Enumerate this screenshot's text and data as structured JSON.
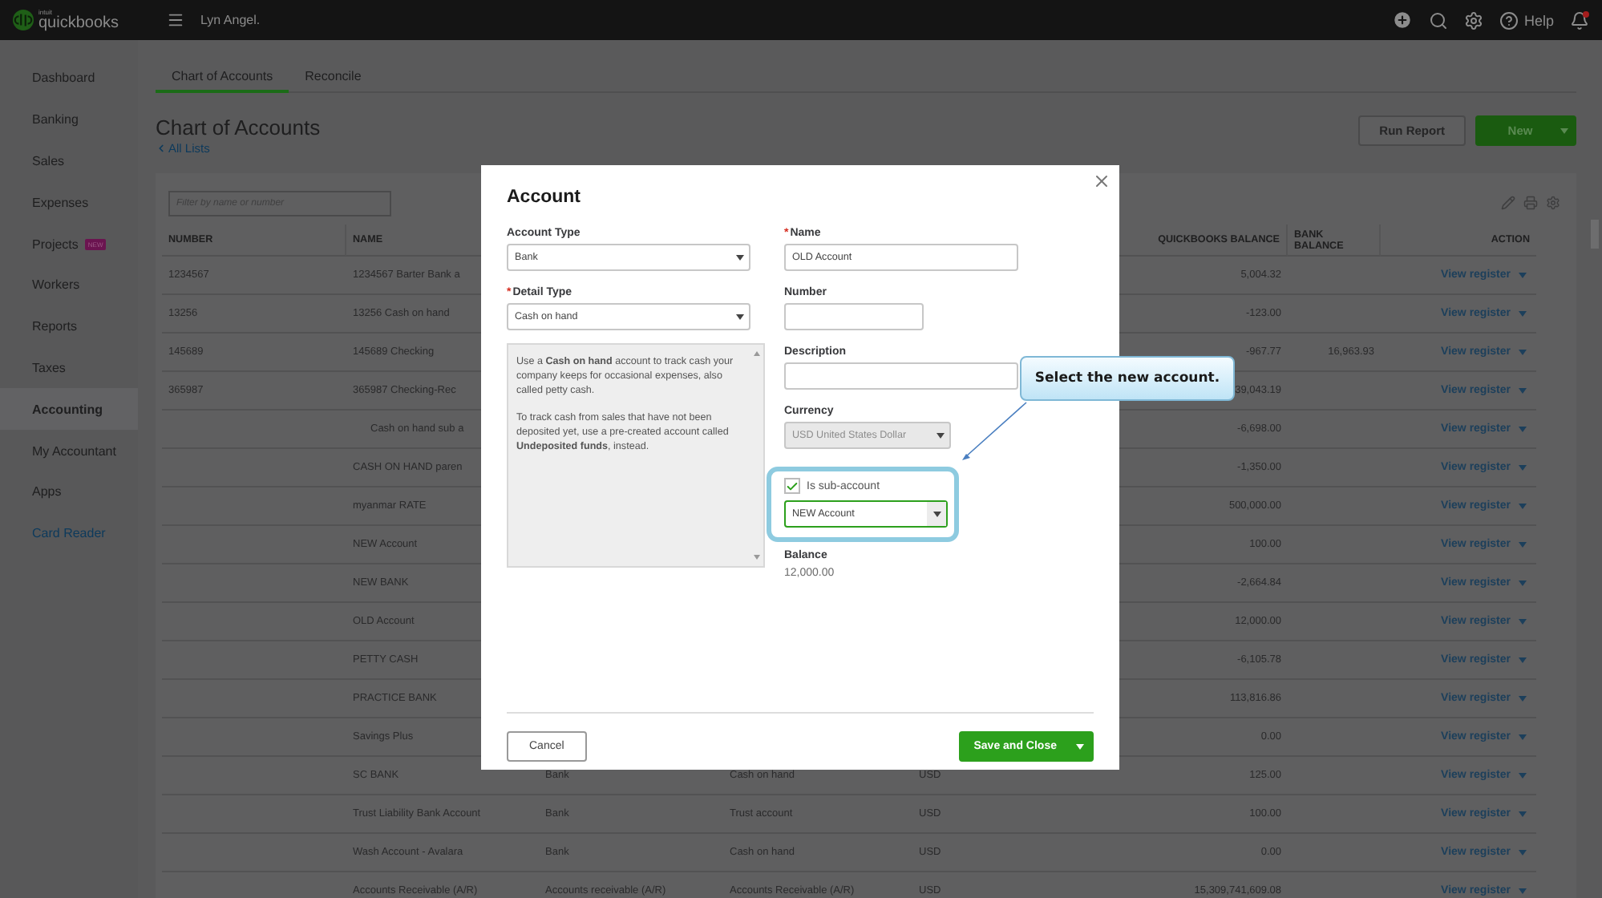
{
  "top_bar": {
    "logo": {
      "brand": "intuit",
      "name": "quickbooks"
    },
    "user": "Lyn Angel.",
    "help": "Help"
  },
  "sidebar": {
    "items": [
      {
        "label": "Dashboard",
        "selected": false,
        "kind": "nav"
      },
      {
        "label": "Banking",
        "selected": false,
        "kind": "nav"
      },
      {
        "label": "Sales",
        "selected": false,
        "kind": "nav"
      },
      {
        "label": "Expenses",
        "selected": false,
        "kind": "nav"
      },
      {
        "label": "Projects",
        "selected": false,
        "kind": "nav",
        "badge": "NEW"
      },
      {
        "label": "Workers",
        "selected": false,
        "kind": "nav"
      },
      {
        "label": "Reports",
        "selected": false,
        "kind": "nav"
      },
      {
        "label": "Taxes",
        "selected": false,
        "kind": "nav"
      },
      {
        "label": "Accounting",
        "selected": true,
        "kind": "nav"
      },
      {
        "label": "My Accountant",
        "selected": false,
        "kind": "nav"
      },
      {
        "label": "Apps",
        "selected": false,
        "kind": "nav"
      },
      {
        "label": "Card Reader",
        "selected": false,
        "kind": "link"
      }
    ]
  },
  "tabs": [
    {
      "label": "Chart of Accounts",
      "selected": true
    },
    {
      "label": "Reconcile",
      "selected": false
    }
  ],
  "page": {
    "title": "Chart of Accounts",
    "back_link": "All Lists",
    "buttons": [
      {
        "label": "Run Report",
        "kind": "secondary"
      },
      {
        "label": "New",
        "kind": "primary"
      }
    ]
  },
  "table": {
    "filter": {
      "placeholder": "Filter by name or number"
    },
    "columns": {
      "number": "NUMBER",
      "name": "NAME",
      "quickbooks_balance": "QUICKBOOKS BALANCE",
      "bank_balance": "BANK BALANCE",
      "action": "ACTION"
    },
    "rows": [
      {
        "number": "1234567",
        "name": "1234567 Barter Bank a",
        "quickbooks_balance": "5,004.32",
        "action": "View register"
      },
      {
        "number": "13256",
        "name": "13256 Cash on hand",
        "quickbooks_balance": "-123.00",
        "action": "View register"
      },
      {
        "number": "145689",
        "name": "145689 Checking",
        "quickbooks_balance": "-967.77",
        "bank_balance": "16,963.93",
        "action": "View register"
      },
      {
        "number": "365987",
        "name": "365987 Checking-Rec",
        "quickbooks_balance": "39,043.19",
        "action": "View register",
        "children": [
          {
            "name": "Cash on hand sub a",
            "quickbooks_balance": "-6,698.00",
            "action": "View register"
          }
        ]
      },
      {
        "name": "CASH ON HAND paren",
        "quickbooks_balance": "-1,350.00",
        "action": "View register"
      },
      {
        "name": "myanmar RATE",
        "quickbooks_balance": "500,000.00",
        "action": "View register"
      },
      {
        "name": "NEW Account",
        "quickbooks_balance": "100.00",
        "action": "View register"
      },
      {
        "name": "NEW BANK",
        "quickbooks_balance": "-2,664.84",
        "action": "View register"
      },
      {
        "name": "OLD Account",
        "quickbooks_balance": "12,000.00",
        "action": "View register"
      },
      {
        "name": "PETTY CASH",
        "quickbooks_balance": "-6,105.78",
        "action": "View register"
      },
      {
        "name": "PRACTICE BANK",
        "quickbooks_balance": "113,816.86",
        "action": "View register"
      },
      {
        "name": "Savings Plus",
        "quickbooks_balance": "0.00",
        "action": "View register"
      },
      {
        "name": "SC BANK",
        "column_3": "Bank",
        "column_4": "Cash on hand",
        "column_5": "USD",
        "quickbooks_balance": "125.00",
        "action": "View register"
      },
      {
        "name": "Trust Liability Bank Account",
        "column_3": "Bank",
        "column_4": "Trust account",
        "column_5": "USD",
        "quickbooks_balance": "100.00",
        "action": "View register"
      },
      {
        "name": "Wash Account - Avalara",
        "column_3": "Bank",
        "column_4": "Cash on hand",
        "column_5": "USD",
        "quickbooks_balance": "0.00",
        "action": "View register"
      },
      {
        "name": "Accounts Receivable (A/R)",
        "column_3": "Accounts receivable (A/R)",
        "column_4": "Accounts Receivable (A/R)",
        "column_5": "USD",
        "quickbooks_balance": "15,309,741,609.08",
        "action": "View register"
      }
    ]
  },
  "modal": {
    "title": "Account",
    "required_mark": "*",
    "account_type": {
      "label": "Account Type",
      "required": false,
      "value": "Bank"
    },
    "detail_type": {
      "label": "Detail Type",
      "required": true,
      "value": "Cash on hand"
    },
    "description_help": [
      "Use a **Cash on hand** account to track cash your company keeps for occasional expenses, also called petty cash.",
      "To track cash from sales that have not been deposited yet, use a pre-created account called **Undeposited funds**, instead."
    ],
    "name": {
      "label": "Name",
      "required": true,
      "value": "OLD Account"
    },
    "number": {
      "label": "Number",
      "required": false
    },
    "description": {
      "label": "Description",
      "required": false
    },
    "currency": {
      "label": "Currency",
      "required": false,
      "value": "USD United States Dollar",
      "disabled": true
    },
    "sub_account": {
      "label": "Is sub-account",
      "checked": true,
      "parent": "NEW Account"
    },
    "balance": {
      "label": "Balance",
      "value": "12,000.00"
    },
    "buttons": [
      {
        "label": "Cancel",
        "kind": "secondary"
      },
      {
        "label": "Save and Close",
        "kind": "primary"
      }
    ]
  },
  "callout": {
    "text": "Select the new account."
  }
}
